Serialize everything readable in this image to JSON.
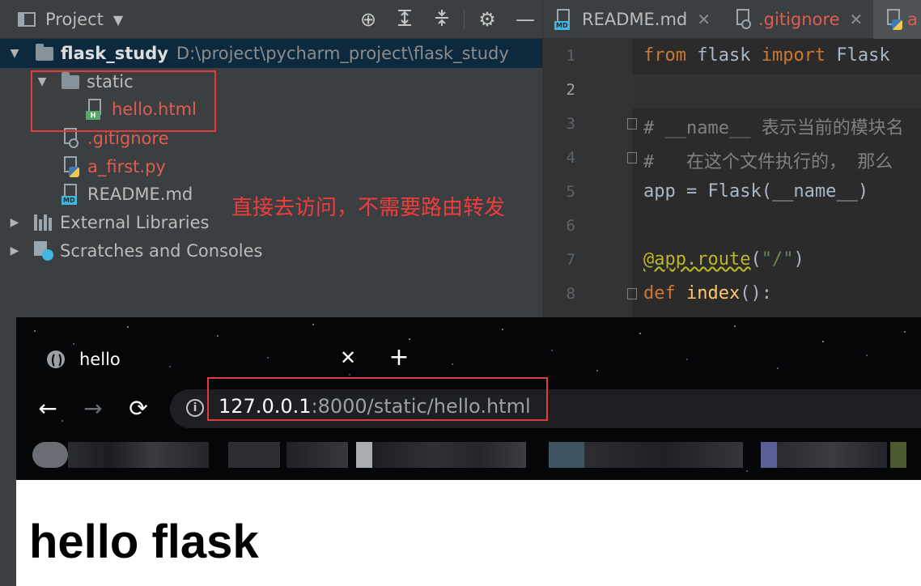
{
  "project_panel": {
    "title": "Project",
    "root": {
      "name": "flask_study",
      "path": "D:\\project\\pycharm_project\\flask_study"
    },
    "folder_static": "static",
    "file_hello": "hello.html",
    "file_gitignore": ".gitignore",
    "file_first": "a_first.py",
    "file_readme": "README.md",
    "external_libraries": "External Libraries",
    "scratches": "Scratches and Consoles",
    "annotation": "直接去访问，不需要路由转发"
  },
  "editor": {
    "tabs": [
      {
        "label": "README.md"
      },
      {
        "label": ".gitignore"
      },
      {
        "label": "a"
      }
    ],
    "line_numbers": [
      "1",
      "2",
      "3",
      "4",
      "5",
      "6",
      "7",
      "8"
    ],
    "lines": {
      "l1_kw1": "from",
      "l1_mod": " flask ",
      "l1_kw2": "import",
      "l1_name": " Flask",
      "l3": "# __name__ 表示当前的模块名",
      "l4": "#   在这个文件执行的， 那么",
      "l5": "app = Flask(__name__)",
      "l7_dec": "@app.route",
      "l7_open": "(",
      "l7_str": "\"/\"",
      "l7_close": ")",
      "l8_kw": "def",
      "l8_fn": " index",
      "l8_rest": "():"
    }
  },
  "browser": {
    "tab_title": "hello",
    "url_host": "127.0.0.1",
    "url_rest": ":8000/static/hello.html",
    "page_heading": "hello flask"
  },
  "colors": {
    "annotation_red": "#f03b3b",
    "highlight_box": "#e03c3c",
    "ide_bg": "#3c3f41",
    "editor_bg": "#2b2b2b",
    "keyword": "#cc7832"
  }
}
